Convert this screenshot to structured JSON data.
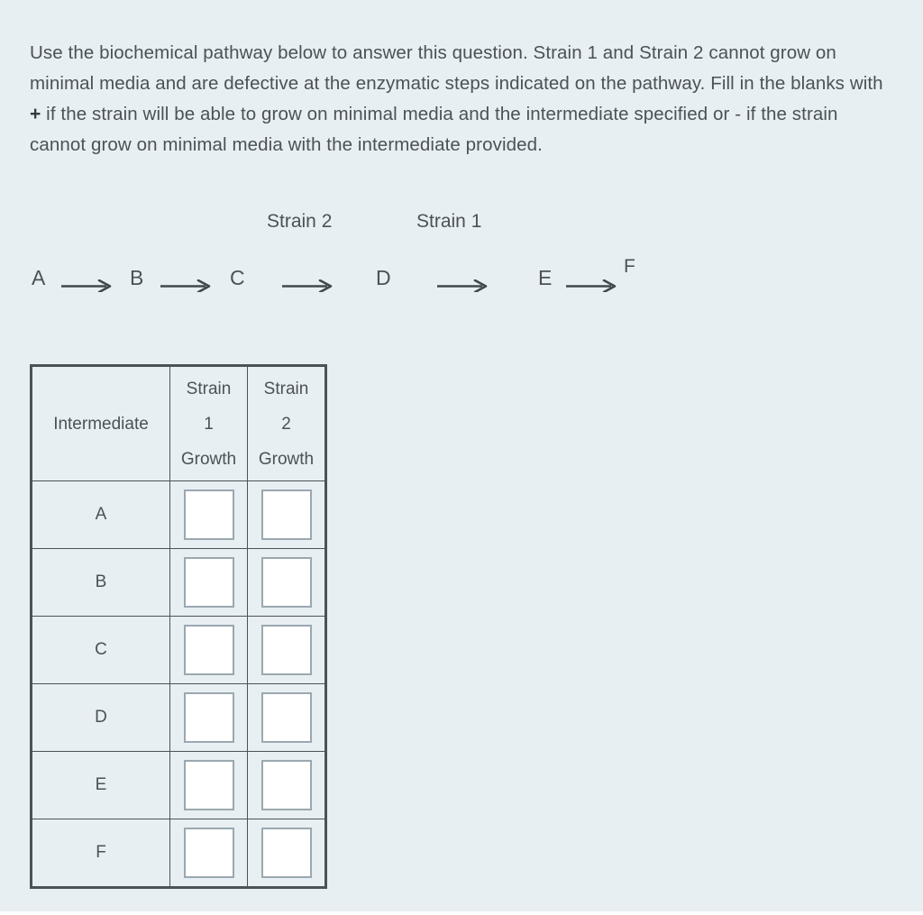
{
  "page": {
    "background_color": "#e8eff2",
    "text_color": "#4a5257"
  },
  "prompt": {
    "part1": "Use the biochemical pathway below to answer this question. Strain 1 and Strain 2 cannot grow on minimal media and are defective at the enzymatic steps indicated on the pathway. Fill in the blanks with ",
    "plus_symbol": "+",
    "part2": " if the strain will be able to grow on minimal media and the intermediate specified or - if the strain cannot grow on minimal media with the intermediate provided."
  },
  "pathway": {
    "nodes": [
      "A",
      "B",
      "C",
      "D",
      "E",
      "F"
    ],
    "arrow_icon": "right-arrow-icon",
    "strain_labels": [
      {
        "text": "Strain 2",
        "above_step": "C to D"
      },
      {
        "text": "Strain 1",
        "above_step": "D to E"
      }
    ]
  },
  "table": {
    "headers": {
      "intermediate": "Intermediate",
      "strain1_line1": "Strain",
      "strain1_line2": "1",
      "strain1_line3": "Growth",
      "strain2_line1": "Strain",
      "strain2_line2": "2",
      "strain2_line3": "Growth"
    },
    "rows": [
      {
        "intermediate": "A",
        "strain1_growth": "",
        "strain2_growth": ""
      },
      {
        "intermediate": "B",
        "strain1_growth": "",
        "strain2_growth": ""
      },
      {
        "intermediate": "C",
        "strain1_growth": "",
        "strain2_growth": ""
      },
      {
        "intermediate": "D",
        "strain1_growth": "",
        "strain2_growth": ""
      },
      {
        "intermediate": "E",
        "strain1_growth": "",
        "strain2_growth": ""
      },
      {
        "intermediate": "F",
        "strain1_growth": "",
        "strain2_growth": ""
      }
    ]
  }
}
